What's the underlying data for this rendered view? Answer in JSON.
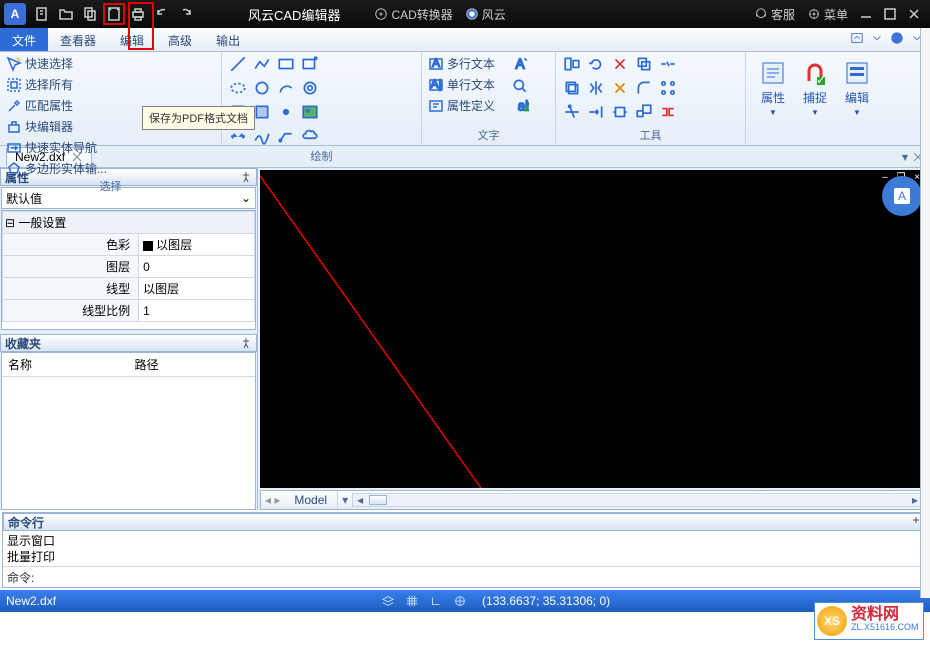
{
  "titlebar": {
    "title": "风云CAD编辑器",
    "btns": {
      "converter": "CAD转换器",
      "fengyun": "风云",
      "service": "客服",
      "menu": "菜单"
    }
  },
  "menus": {
    "file": "文件",
    "viewer": "查看器",
    "edit": "编辑",
    "adv": "高级",
    "output": "输出"
  },
  "tooltip": "保存为PDF格式文档",
  "ribbon": {
    "select": {
      "label": "选择",
      "quick": "快速选择",
      "all": "选择所有",
      "match": "匹配属性",
      "block": "块编辑器",
      "entity": "快速实体导航",
      "poly": "多边形实体输入"
    },
    "draw": {
      "label": "绘制"
    },
    "text": {
      "label": "文字",
      "multi": "多行文本",
      "single": "单行文本",
      "attr": "属性定义"
    },
    "tool": {
      "label": "工具"
    },
    "prop": "属性",
    "snap": "捕捉",
    "editbtn": "编辑"
  },
  "filetab": {
    "name": "New2.dxf"
  },
  "proppanel": {
    "title": "属性",
    "combo": "默认值",
    "hdr": "一般设置",
    "rows": {
      "color": "色彩",
      "color_v": "以图层",
      "layer": "图层",
      "layer_v": "0",
      "ltype": "线型",
      "ltype_v": "以图层",
      "lscale": "线型比例",
      "lscale_v": "1"
    }
  },
  "favpanel": {
    "title": "收藏夹",
    "col1": "名称",
    "col2": "路径"
  },
  "modeltab": "Model",
  "cmdline": {
    "title": "命令行",
    "l1": "显示窗口",
    "l2": "批量打印",
    "prompt": "命令:"
  },
  "status": {
    "file": "New2.dxf",
    "coords": "(133.6637; 35.31306; 0)"
  },
  "watermark": {
    "t1": "资料网",
    "t2": "ZL.X51616.COM",
    "badge": "XS"
  }
}
